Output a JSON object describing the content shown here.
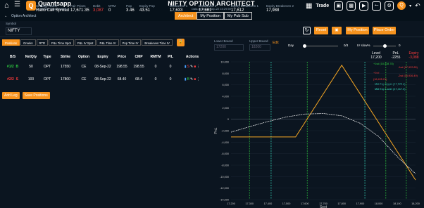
{
  "app": {
    "brand": "Quantsapp",
    "tagline": "Optimize Opportunities",
    "title": "NIFTY OPTION ARCHITECT",
    "subtitle": "Data as on 08-Sep-22 15:29:59",
    "breadcrumb": "Option Architect"
  },
  "top_tabs": [
    {
      "label": "Architect",
      "active": true
    },
    {
      "label": "My Position",
      "active": false
    },
    {
      "label": "My Pub Sub",
      "active": false
    }
  ],
  "trade_label": "Trade",
  "avatar": "Q",
  "summary": {
    "symbol_label": "Symbol",
    "symbol": "NIFTY",
    "strategy_name_label": "Strategy Name",
    "strategy_name": "Ratio Call Spread",
    "fair_prices_label": "Fair Prices",
    "fair_prices": "17,671.35",
    "debit_label": "Debit",
    "debit": "3,087",
    "mtm_label": "MTM",
    "mtm": "0",
    "pop_label": "Pop",
    "pop": "3.46",
    "expiry_pop_label": "Expiry Pop",
    "expiry_pop": "43.51",
    "be1_label": "Breakeven 1",
    "be1": "17,633",
    "be2_label": "Breakeven 2",
    "be2": "17,661",
    "ebe1_label": "Expiry Breakeven 1",
    "ebe1": "17,612",
    "ebe2_label": "Expiry Breakeven 2",
    "ebe2": "17,988"
  },
  "buttons": {
    "reset": "Reset",
    "my_position": "My Position",
    "place_order": "Place Order",
    "add_leg": "Add Leg",
    "save_positions": "Save Positions"
  },
  "subtabs": [
    {
      "label": "Positions",
      "active": true
    },
    {
      "label": "Greeks",
      "active": false
    },
    {
      "label": "RTR",
      "active": false
    },
    {
      "label": "P&L Time Spot",
      "active": false
    },
    {
      "label": "P&L IV Spot",
      "active": false
    },
    {
      "label": "P&L Time IV",
      "active": false
    },
    {
      "label": "Pop Time IV",
      "active": false
    },
    {
      "label": "Breakeven Time IV",
      "active": false
    }
  ],
  "table": {
    "headers": [
      "B/S",
      "NetQty",
      "Type",
      "Strike",
      "Option",
      "Expiry",
      "Price",
      "CMP",
      "RMTM",
      "P/L",
      "Actions"
    ],
    "rows": [
      {
        "leg": "#1/2",
        "bs": "B",
        "side": "buy",
        "qty": "50",
        "type": "OPT",
        "strike": "17550",
        "option": "CE",
        "expiry": "08-Sep-22",
        "price": "198.55",
        "cmp": "198.55",
        "rmtm": "0",
        "pl": "0"
      },
      {
        "leg": "#2/2",
        "bs": "S",
        "side": "sell",
        "qty": "100",
        "type": "OPT",
        "strike": "17800",
        "option": "CE",
        "expiry": "08-Sep-22",
        "price": "68.40",
        "cmp": "68.4",
        "rmtm": "0",
        "pl": "0"
      }
    ]
  },
  "controls": {
    "lower_bound_label": "Lower Bound",
    "lower_bound": "17200",
    "upper_bound_label": "Upper Bound",
    "upper_bound": "18200",
    "edit": "Edit",
    "day_label": "Day",
    "day_value": "0/3",
    "iv_label": "IV slow%",
    "iv_value": "0"
  },
  "level_box": {
    "level_label": "Level",
    "level_value": "17,200",
    "pnl_label": "PnL",
    "pnl_value": "-2255",
    "expiry_label": "Expiry",
    "expiry_value": "-3,088"
  },
  "legend": [
    {
      "label": "+1sd (18,038.78)",
      "color": "#2ecc40"
    },
    {
      "label": "-1sd (17,922.85)",
      "color": "#ff3b3b"
    },
    {
      "label": "+2sd",
      "color": "#ff3b3b"
    },
    {
      "label": "-2sd (16,936.49)",
      "color": "#ff3b3b"
    },
    {
      "label": "(16,405.21)",
      "color": "#ff3b3b"
    },
    {
      "label": "Mkt Exp Upper (17,925.4)",
      "color": "#39e6c8"
    },
    {
      "label": "Mkt Exp Lower (17,417.3)",
      "color": "#39e6c8"
    }
  ],
  "chart_data": {
    "type": "line",
    "xlabel": "Spot",
    "ylabel": "PnL",
    "xlim": [
      17200,
      18200
    ],
    "ylim": [
      -14000,
      10000
    ],
    "x_ticks": [
      "17,200",
      "17,300",
      "17,400",
      "17,500",
      "17,600",
      "17,700",
      "17,800",
      "17,900",
      "18,000",
      "18,100",
      "18,200"
    ],
    "y_ticks": [
      "10,000",
      "8,000",
      "6,000",
      "4,000",
      "2,000",
      "0",
      "-2,000",
      "-4,000",
      "-6,000",
      "-8,000",
      "-10,000",
      "-12,000",
      "-14,000"
    ],
    "series": [
      {
        "x": [
          17200,
          17550,
          17800,
          18200
        ],
        "values": [
          -3088,
          -3088,
          9412,
          -10588
        ],
        "color": "#f5a623"
      },
      {
        "x": [
          17200,
          17300,
          17400,
          17500,
          17600,
          17700,
          17800,
          17900,
          18000,
          18100,
          18200
        ],
        "values": [
          -2255,
          -1300,
          -400,
          400,
          900,
          1000,
          600,
          -700,
          -3000,
          -6500,
          -9500
        ],
        "color": "#ffffff"
      }
    ],
    "vlines": [
      {
        "x": 17300,
        "color": "#2ecc40"
      },
      {
        "x": 17417.3,
        "color": "#39e6c8"
      },
      {
        "x": 17613,
        "color": "#2ecc40"
      },
      {
        "x": 17925.4,
        "color": "#39e6c8"
      },
      {
        "x": 18039,
        "color": "#2ecc40"
      },
      {
        "x": 18150,
        "color": "#2ecc40"
      }
    ],
    "hline": 0
  }
}
